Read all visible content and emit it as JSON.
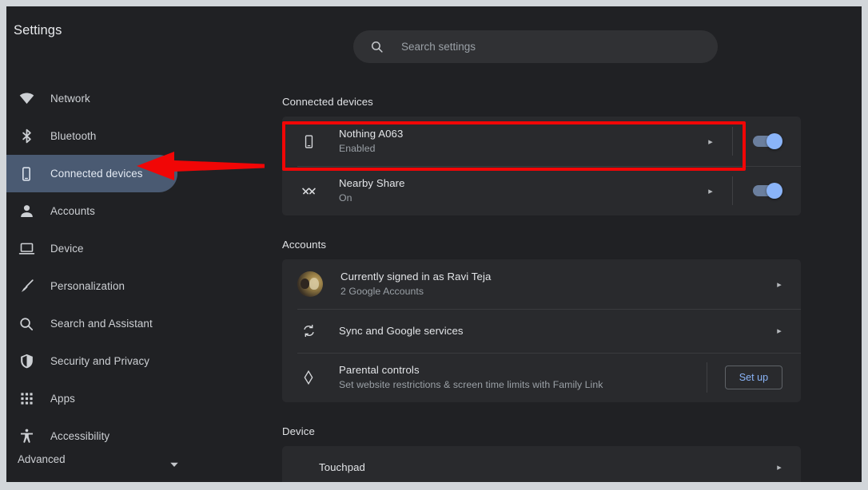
{
  "window": {
    "app_title": "Settings"
  },
  "search": {
    "icon": "search-icon",
    "placeholder": "Search settings",
    "value": ""
  },
  "sidebar": {
    "items": [
      {
        "id": "network",
        "label": "Network",
        "icon": "wifi-icon",
        "active": false
      },
      {
        "id": "bluetooth",
        "label": "Bluetooth",
        "icon": "bluetooth-icon",
        "active": false
      },
      {
        "id": "connected-devices",
        "label": "Connected devices",
        "icon": "phone-icon",
        "active": true
      },
      {
        "id": "accounts",
        "label": "Accounts",
        "icon": "person-icon",
        "active": false
      },
      {
        "id": "device",
        "label": "Device",
        "icon": "laptop-icon",
        "active": false
      },
      {
        "id": "personalization",
        "label": "Personalization",
        "icon": "brush-icon",
        "active": false
      },
      {
        "id": "search-assistant",
        "label": "Search and Assistant",
        "icon": "search-icon",
        "active": false
      },
      {
        "id": "security-privacy",
        "label": "Security and Privacy",
        "icon": "shield-icon",
        "active": false
      },
      {
        "id": "apps",
        "label": "Apps",
        "icon": "grid-apps-icon",
        "active": false
      },
      {
        "id": "accessibility",
        "label": "Accessibility",
        "icon": "accessibility-icon",
        "active": false
      }
    ],
    "advanced": {
      "label": "Advanced",
      "caret_icon": "chevron-down-icon"
    },
    "active_highlight_color": "#4a5a72"
  },
  "main": {
    "sections": [
      {
        "id": "connected-devices",
        "heading": "Connected devices",
        "rows": [
          {
            "id": "nothing-a063",
            "icon": "phone-icon",
            "title": "Nothing A063",
            "subtitle": "Enabled",
            "chevron": "chevron-right-icon",
            "toggle": {
              "state": "on",
              "label": "toggle-on"
            },
            "highlighted": true
          },
          {
            "id": "nearby-share",
            "icon": "nearby-share-icon",
            "title": "Nearby Share",
            "subtitle": "On",
            "chevron": "chevron-right-icon",
            "toggle": {
              "state": "on",
              "label": "toggle-on"
            },
            "highlighted": false
          }
        ]
      },
      {
        "id": "accounts",
        "heading": "Accounts",
        "rows": [
          {
            "id": "signed-in-account",
            "icon": "avatar",
            "title": "Currently signed in as Ravi Teja",
            "subtitle": "2 Google Accounts",
            "chevron": "chevron-right-icon"
          },
          {
            "id": "sync-google-services",
            "icon": "sync-icon",
            "title": "Sync and Google services",
            "subtitle": "",
            "chevron": "chevron-right-icon"
          },
          {
            "id": "parental-controls",
            "icon": "family-link-icon",
            "title": "Parental controls",
            "subtitle": "Set website restrictions & screen time limits with Family Link",
            "button": "Set up"
          }
        ]
      },
      {
        "id": "device",
        "heading": "Device",
        "rows": [
          {
            "id": "touchpad",
            "icon": "",
            "title": "Touchpad",
            "subtitle": "",
            "chevron": "chevron-right-icon"
          }
        ]
      }
    ]
  },
  "annotations": {
    "highlight_box": {
      "name": "red-highlight-box",
      "color": "#f10606",
      "target": "Nothing A063"
    },
    "pointer_arrow": {
      "name": "red-arrow",
      "color": "#f10606",
      "target": "Connected devices",
      "direction": "left"
    }
  },
  "colors": {
    "page_background": "#202124",
    "card_background": "#292a2d",
    "accent_blue": "#8ab4f8",
    "annotation_red": "#f10606",
    "text_primary": "#e3e5e8",
    "text_secondary": "#9aa0a6"
  },
  "glyphs": {
    "chevron_right": "▸"
  }
}
